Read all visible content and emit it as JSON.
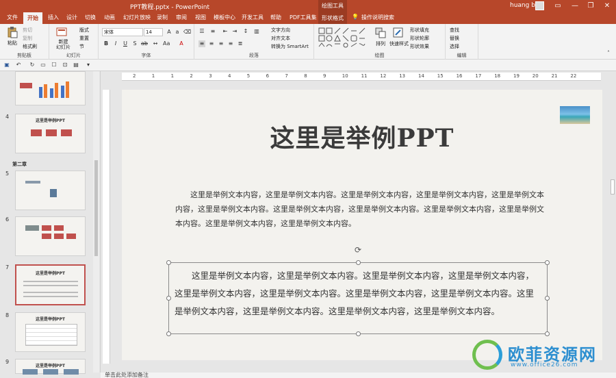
{
  "window": {
    "title": "PPT教程.pptx  -  PowerPoint",
    "context_tool_group": "绘图工具",
    "user_name": "huang bo",
    "controls": [
      "—",
      "❐",
      "✕"
    ]
  },
  "tabs": [
    {
      "label": "文件"
    },
    {
      "label": "开始",
      "active": true
    },
    {
      "label": "插入"
    },
    {
      "label": "设计"
    },
    {
      "label": "切换"
    },
    {
      "label": "动画"
    },
    {
      "label": "幻灯片放映"
    },
    {
      "label": "录制"
    },
    {
      "label": "审阅"
    },
    {
      "label": "视图"
    },
    {
      "label": "模板中心"
    },
    {
      "label": "开发工具"
    },
    {
      "label": "帮助"
    },
    {
      "label": "PDF工具集"
    },
    {
      "label": "形状格式",
      "context": true
    },
    {
      "label": "操作说明搜索"
    }
  ],
  "ribbon": {
    "clipboard": {
      "group": "剪贴板",
      "paste": "粘贴",
      "cut": "剪切",
      "copy": "复制",
      "format_painter": "格式刷"
    },
    "slides": {
      "group": "幻灯片",
      "new_slide": "新建\n幻灯片",
      "layout": "版式",
      "reset": "重置",
      "section": "节"
    },
    "font": {
      "group": "字体",
      "font_name": "宋体",
      "font_size": "14"
    },
    "paragraph": {
      "group": "段落",
      "text_direction": "文字方向",
      "align_text": "对齐文本",
      "smartart": "转换为 SmartArt"
    },
    "drawing": {
      "group": "绘图",
      "arrange": "排列",
      "quick_styles": "快速样式",
      "shape_fill": "形状填充",
      "shape_outline": "形状轮廓",
      "shape_effects": "形状效果"
    },
    "editing": {
      "group": "编辑",
      "find": "查找",
      "replace": "替换",
      "select": "选择"
    }
  },
  "slides_panel": {
    "section_label": "第二章",
    "thumbs": [
      {
        "num": "",
        "title": ""
      },
      {
        "num": "4",
        "title": "这里是举例PPT"
      },
      {
        "num": "5",
        "title": ""
      },
      {
        "num": "6",
        "title": ""
      },
      {
        "num": "7",
        "title": "这里是举例PPT",
        "selected": true
      },
      {
        "num": "8",
        "title": "这里是举例PPT"
      },
      {
        "num": "9",
        "title": "这里是举例PPT"
      }
    ]
  },
  "ruler": {
    "marks": [
      "2",
      "1",
      "1",
      "2",
      "3",
      "4",
      "5",
      "6",
      "7",
      "8",
      "9",
      "10",
      "11",
      "12",
      "13",
      "14",
      "15",
      "16",
      "17",
      "18",
      "19",
      "20",
      "21",
      "22"
    ]
  },
  "slide": {
    "title": "这里是举例PPT",
    "paragraph1": "这里是举例文本内容，这里是举例文本内容。这里是举例文本内容，这里是举例文本内容，这里是举例文本内容，这里是举例文本内容。这里是举例文本内容，这里是举例文本内容。这里是举例文本内容，这里是举例文本内容。这里是举例文本内容，这里是举例文本内容。",
    "paragraph2": "这里是举例文本内容，这里是举例文本内容。这里是举例文本内容，这里是举例文本内容，这里是举例文本内容，这里是举例文本内容。这里是举例文本内容，这里是举例文本内容。这里是举例文本内容，这里是举例文本内容。这里是举例文本内容，这里是举例文本内容。"
  },
  "notes_placeholder": "单击此处添加备注",
  "watermark": {
    "text": "欧菲资源网",
    "url": "www.office26.com"
  },
  "colors": {
    "accent": "#b7472a",
    "context_tab": "#9b3b22",
    "selected_thumb_border": "#c0504d"
  }
}
